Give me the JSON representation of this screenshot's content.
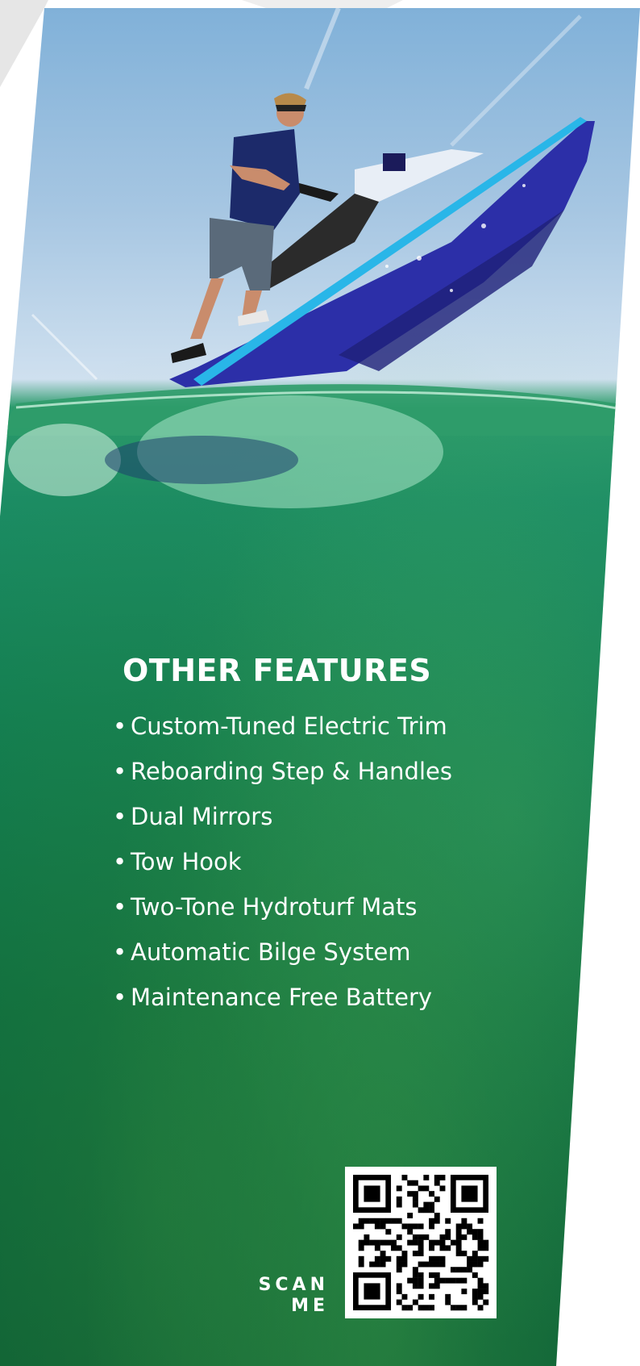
{
  "features": {
    "heading": "OTHER FEATURES",
    "items": [
      "Custom-Tuned Electric Trim",
      "Reboarding Step & Handles",
      "Dual Mirrors",
      "Tow Hook",
      "Two-Tone Hydroturf Mats",
      "Automatic Bilge System",
      "Maintenance Free Battery"
    ]
  },
  "qr": {
    "label_line1": "SCAN",
    "label_line2": "ME"
  },
  "colors": {
    "text": "#ffffff",
    "water_deep": "#0b5d35",
    "water_light": "#1b8c64",
    "sky": "#a6c6e2",
    "jetski_hull": "#2c2fa8",
    "jetski_stripe": "#29b6e8"
  }
}
